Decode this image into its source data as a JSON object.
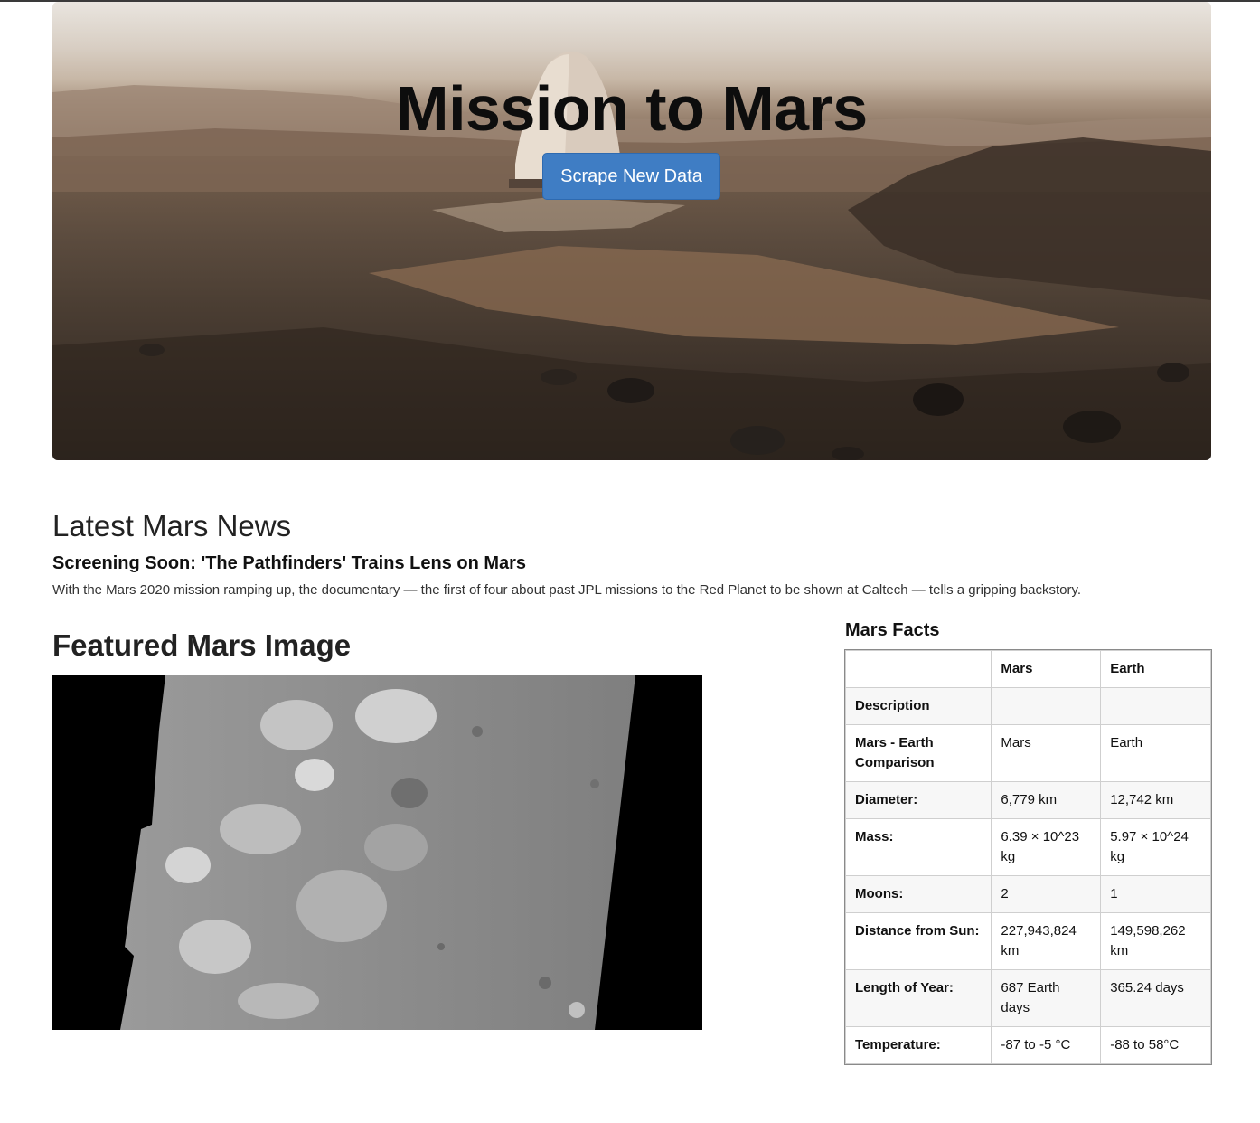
{
  "hero": {
    "title": "Mission to Mars",
    "scrape_button": "Scrape New Data",
    "brand_color": "#3f7dc4"
  },
  "news": {
    "heading": "Latest Mars News",
    "title": "Screening Soon: 'The Pathfinders' Trains Lens on Mars",
    "paragraph": "With the Mars 2020 mission ramping up, the documentary — the first of four about past JPL missions to the Red Planet to be shown at Caltech — tells a gripping backstory."
  },
  "featured": {
    "heading": "Featured Mars Image"
  },
  "facts": {
    "heading": "Mars Facts",
    "columns": [
      "",
      "Mars",
      "Earth"
    ],
    "rows": [
      [
        "Description",
        "",
        ""
      ],
      [
        "Mars - Earth Comparison",
        "Mars",
        "Earth"
      ],
      [
        "Diameter:",
        "6,779 km",
        "12,742 km"
      ],
      [
        "Mass:",
        "6.39 × 10^23 kg",
        "5.97 × 10^24 kg"
      ],
      [
        "Moons:",
        "2",
        "1"
      ],
      [
        "Distance from Sun:",
        "227,943,824 km",
        "149,598,262 km"
      ],
      [
        "Length of Year:",
        "687 Earth days",
        "365.24 days"
      ],
      [
        "Temperature:",
        "-87 to -5 °C",
        "-88 to 58°C"
      ]
    ]
  }
}
